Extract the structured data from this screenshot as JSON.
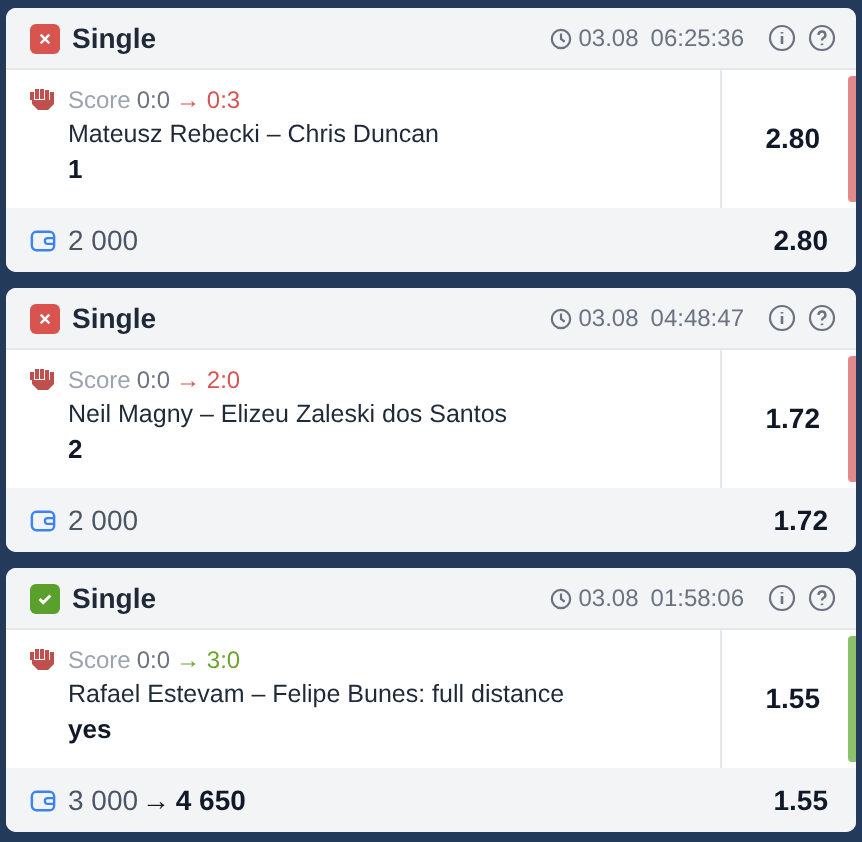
{
  "bets": [
    {
      "won": false,
      "title": "Single",
      "date": "03.08",
      "time": "06:25:36",
      "score_label": "Score",
      "score_from": "0:0",
      "arrow": "→",
      "score_to": "0:3",
      "event": "Mateusz Rebecki – Chris Duncan",
      "pick": "1",
      "odds": "2.80",
      "stake": "2 000",
      "total_odds": "2.80"
    },
    {
      "won": false,
      "title": "Single",
      "date": "03.08",
      "time": "04:48:47",
      "score_label": "Score",
      "score_from": "0:0",
      "arrow": "→",
      "score_to": "2:0",
      "event": "Neil Magny – Elizeu Zaleski dos Santos",
      "pick": "2",
      "odds": "1.72",
      "stake": "2 000",
      "total_odds": "1.72"
    },
    {
      "won": true,
      "title": "Single",
      "date": "03.08",
      "time": "01:58:06",
      "score_label": "Score",
      "score_from": "0:0",
      "arrow": "→",
      "score_to": "3:0",
      "event": "Rafael Estevam – Felipe Bunes: full distance",
      "pick": "yes",
      "odds": "1.55",
      "stake": "3 000",
      "payout_arrow": "→",
      "payout": "4 650",
      "total_odds": "1.55"
    }
  ]
}
